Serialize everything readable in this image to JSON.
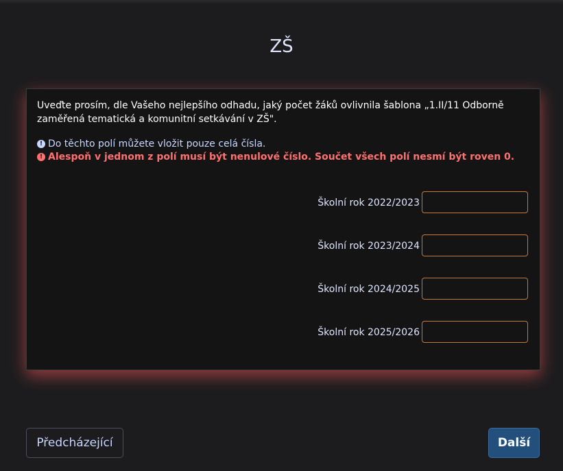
{
  "page": {
    "title": "ZŠ"
  },
  "panel": {
    "question": "Uveďte prosím, dle Vašeho nejlepšího odhadu, jaký počet žáků ovlivnila šablona „1.II/11 Odborně zaměřená tematická a komunitní setkávání v ZŠ\".",
    "info_text": "Do těchto polí můžete vložit pouze celá čísla.",
    "info_icon": "info-circle-icon",
    "error_text": "Alespoň v jednom z polí musí být nenulové číslo. Součet všech polí nesmí být roven 0.",
    "error_icon": "exclamation-circle-icon",
    "rows": [
      {
        "label": "Školní rok 2022/2023",
        "value": ""
      },
      {
        "label": "Školní rok 2023/2024",
        "value": ""
      },
      {
        "label": "Školní rok 2024/2025",
        "value": ""
      },
      {
        "label": "Školní rok 2025/2026",
        "value": ""
      }
    ]
  },
  "nav": {
    "prev_label": "Předcházející",
    "next_label": "Další"
  },
  "colors": {
    "background": "#1c1c1e",
    "panel_background": "#141414",
    "panel_glow": "#ff5a5a",
    "info": "#c8d7ff",
    "error": "#ff7070",
    "field_border": "#c77a3a",
    "next_button": "#234f7c"
  }
}
